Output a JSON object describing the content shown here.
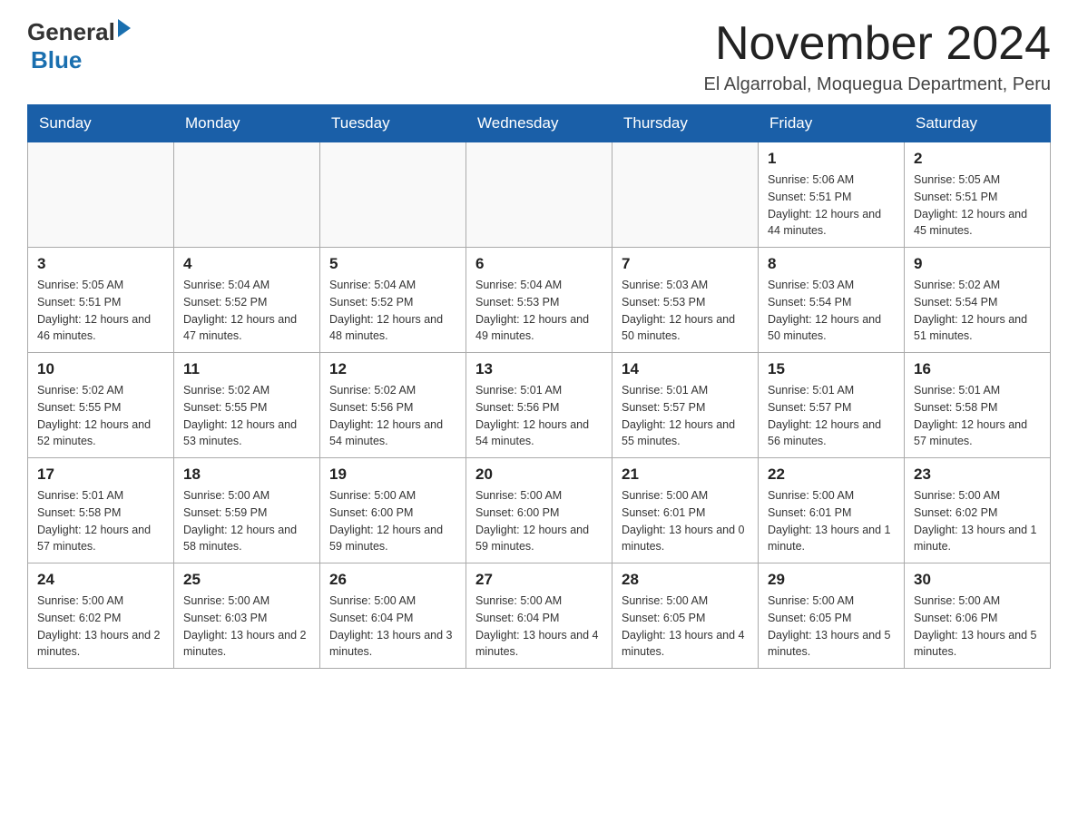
{
  "logo": {
    "general": "General",
    "blue": "Blue"
  },
  "header": {
    "month_year": "November 2024",
    "location": "El Algarrobal, Moquegua Department, Peru"
  },
  "weekdays": [
    "Sunday",
    "Monday",
    "Tuesday",
    "Wednesday",
    "Thursday",
    "Friday",
    "Saturday"
  ],
  "weeks": [
    [
      {
        "day": "",
        "info": ""
      },
      {
        "day": "",
        "info": ""
      },
      {
        "day": "",
        "info": ""
      },
      {
        "day": "",
        "info": ""
      },
      {
        "day": "",
        "info": ""
      },
      {
        "day": "1",
        "info": "Sunrise: 5:06 AM\nSunset: 5:51 PM\nDaylight: 12 hours and 44 minutes."
      },
      {
        "day": "2",
        "info": "Sunrise: 5:05 AM\nSunset: 5:51 PM\nDaylight: 12 hours and 45 minutes."
      }
    ],
    [
      {
        "day": "3",
        "info": "Sunrise: 5:05 AM\nSunset: 5:51 PM\nDaylight: 12 hours and 46 minutes."
      },
      {
        "day": "4",
        "info": "Sunrise: 5:04 AM\nSunset: 5:52 PM\nDaylight: 12 hours and 47 minutes."
      },
      {
        "day": "5",
        "info": "Sunrise: 5:04 AM\nSunset: 5:52 PM\nDaylight: 12 hours and 48 minutes."
      },
      {
        "day": "6",
        "info": "Sunrise: 5:04 AM\nSunset: 5:53 PM\nDaylight: 12 hours and 49 minutes."
      },
      {
        "day": "7",
        "info": "Sunrise: 5:03 AM\nSunset: 5:53 PM\nDaylight: 12 hours and 50 minutes."
      },
      {
        "day": "8",
        "info": "Sunrise: 5:03 AM\nSunset: 5:54 PM\nDaylight: 12 hours and 50 minutes."
      },
      {
        "day": "9",
        "info": "Sunrise: 5:02 AM\nSunset: 5:54 PM\nDaylight: 12 hours and 51 minutes."
      }
    ],
    [
      {
        "day": "10",
        "info": "Sunrise: 5:02 AM\nSunset: 5:55 PM\nDaylight: 12 hours and 52 minutes."
      },
      {
        "day": "11",
        "info": "Sunrise: 5:02 AM\nSunset: 5:55 PM\nDaylight: 12 hours and 53 minutes."
      },
      {
        "day": "12",
        "info": "Sunrise: 5:02 AM\nSunset: 5:56 PM\nDaylight: 12 hours and 54 minutes."
      },
      {
        "day": "13",
        "info": "Sunrise: 5:01 AM\nSunset: 5:56 PM\nDaylight: 12 hours and 54 minutes."
      },
      {
        "day": "14",
        "info": "Sunrise: 5:01 AM\nSunset: 5:57 PM\nDaylight: 12 hours and 55 minutes."
      },
      {
        "day": "15",
        "info": "Sunrise: 5:01 AM\nSunset: 5:57 PM\nDaylight: 12 hours and 56 minutes."
      },
      {
        "day": "16",
        "info": "Sunrise: 5:01 AM\nSunset: 5:58 PM\nDaylight: 12 hours and 57 minutes."
      }
    ],
    [
      {
        "day": "17",
        "info": "Sunrise: 5:01 AM\nSunset: 5:58 PM\nDaylight: 12 hours and 57 minutes."
      },
      {
        "day": "18",
        "info": "Sunrise: 5:00 AM\nSunset: 5:59 PM\nDaylight: 12 hours and 58 minutes."
      },
      {
        "day": "19",
        "info": "Sunrise: 5:00 AM\nSunset: 6:00 PM\nDaylight: 12 hours and 59 minutes."
      },
      {
        "day": "20",
        "info": "Sunrise: 5:00 AM\nSunset: 6:00 PM\nDaylight: 12 hours and 59 minutes."
      },
      {
        "day": "21",
        "info": "Sunrise: 5:00 AM\nSunset: 6:01 PM\nDaylight: 13 hours and 0 minutes."
      },
      {
        "day": "22",
        "info": "Sunrise: 5:00 AM\nSunset: 6:01 PM\nDaylight: 13 hours and 1 minute."
      },
      {
        "day": "23",
        "info": "Sunrise: 5:00 AM\nSunset: 6:02 PM\nDaylight: 13 hours and 1 minute."
      }
    ],
    [
      {
        "day": "24",
        "info": "Sunrise: 5:00 AM\nSunset: 6:02 PM\nDaylight: 13 hours and 2 minutes."
      },
      {
        "day": "25",
        "info": "Sunrise: 5:00 AM\nSunset: 6:03 PM\nDaylight: 13 hours and 2 minutes."
      },
      {
        "day": "26",
        "info": "Sunrise: 5:00 AM\nSunset: 6:04 PM\nDaylight: 13 hours and 3 minutes."
      },
      {
        "day": "27",
        "info": "Sunrise: 5:00 AM\nSunset: 6:04 PM\nDaylight: 13 hours and 4 minutes."
      },
      {
        "day": "28",
        "info": "Sunrise: 5:00 AM\nSunset: 6:05 PM\nDaylight: 13 hours and 4 minutes."
      },
      {
        "day": "29",
        "info": "Sunrise: 5:00 AM\nSunset: 6:05 PM\nDaylight: 13 hours and 5 minutes."
      },
      {
        "day": "30",
        "info": "Sunrise: 5:00 AM\nSunset: 6:06 PM\nDaylight: 13 hours and 5 minutes."
      }
    ]
  ]
}
